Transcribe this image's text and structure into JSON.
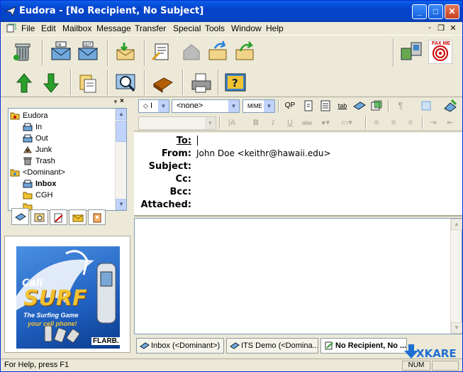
{
  "window": {
    "title": "Eudora - [No Recipient, No Subject]",
    "minimize_glyph": "_",
    "maximize_glyph": "□",
    "close_glyph": "✕"
  },
  "menu": {
    "items": [
      "File",
      "Edit",
      "Mailbox",
      "Message",
      "Transfer",
      "Special",
      "Tools",
      "Window",
      "Help"
    ],
    "mdi_minimize": "-",
    "mdi_restore": "❐",
    "mdi_close": "✕"
  },
  "mailbox_tree": {
    "items": [
      {
        "label": "Eudora",
        "icon": "folder-icon",
        "bold": false
      },
      {
        "label": "In",
        "icon": "inbox-icon",
        "bold": false
      },
      {
        "label": "Out",
        "icon": "outbox-icon",
        "bold": false
      },
      {
        "label": "Junk",
        "icon": "junk-icon",
        "bold": false
      },
      {
        "label": "Trash",
        "icon": "trash-icon",
        "bold": false
      },
      {
        "label": "<Dominant>",
        "icon": "folder-icon",
        "bold": false
      },
      {
        "label": "Inbox",
        "icon": "inbox-icon",
        "bold": true
      },
      {
        "label": "CGH",
        "icon": "folder-icon",
        "bold": false
      }
    ]
  },
  "format_bar": {
    "priority_value": "I",
    "signature_value": "<none>",
    "encoding_value": "MIME",
    "qp_label": "QP",
    "tab_label": "tab"
  },
  "compose_header": {
    "to_label": "To:",
    "from_label": "From:",
    "from_value": "John Doe <keithr@hawaii.edu>",
    "subject_label": "Subject:",
    "cc_label": "Cc:",
    "bcc_label": "Bcc:",
    "attached_label": "Attached:"
  },
  "ad": {
    "brand_top": "Cali",
    "brand_main": "SURF",
    "tagline1": "The Surfing Game",
    "tagline2": "your cell phone!",
    "company": "FLARB."
  },
  "bottom_tabs": [
    {
      "label": "Inbox (<Dominant>)",
      "active": false
    },
    {
      "label": "ITS Demo (<Domina...",
      "active": false
    },
    {
      "label": "No Recipient, No ...",
      "active": true
    }
  ],
  "fax_label": "FAX ME",
  "status": {
    "help_text": "For Help, press F1",
    "num_indicator": "NUM"
  },
  "watermark": "XKARE",
  "colors": {
    "title_blue": "#0642c9",
    "accent_green": "#2aa02a",
    "ad_blue": "#1f5fbf"
  }
}
